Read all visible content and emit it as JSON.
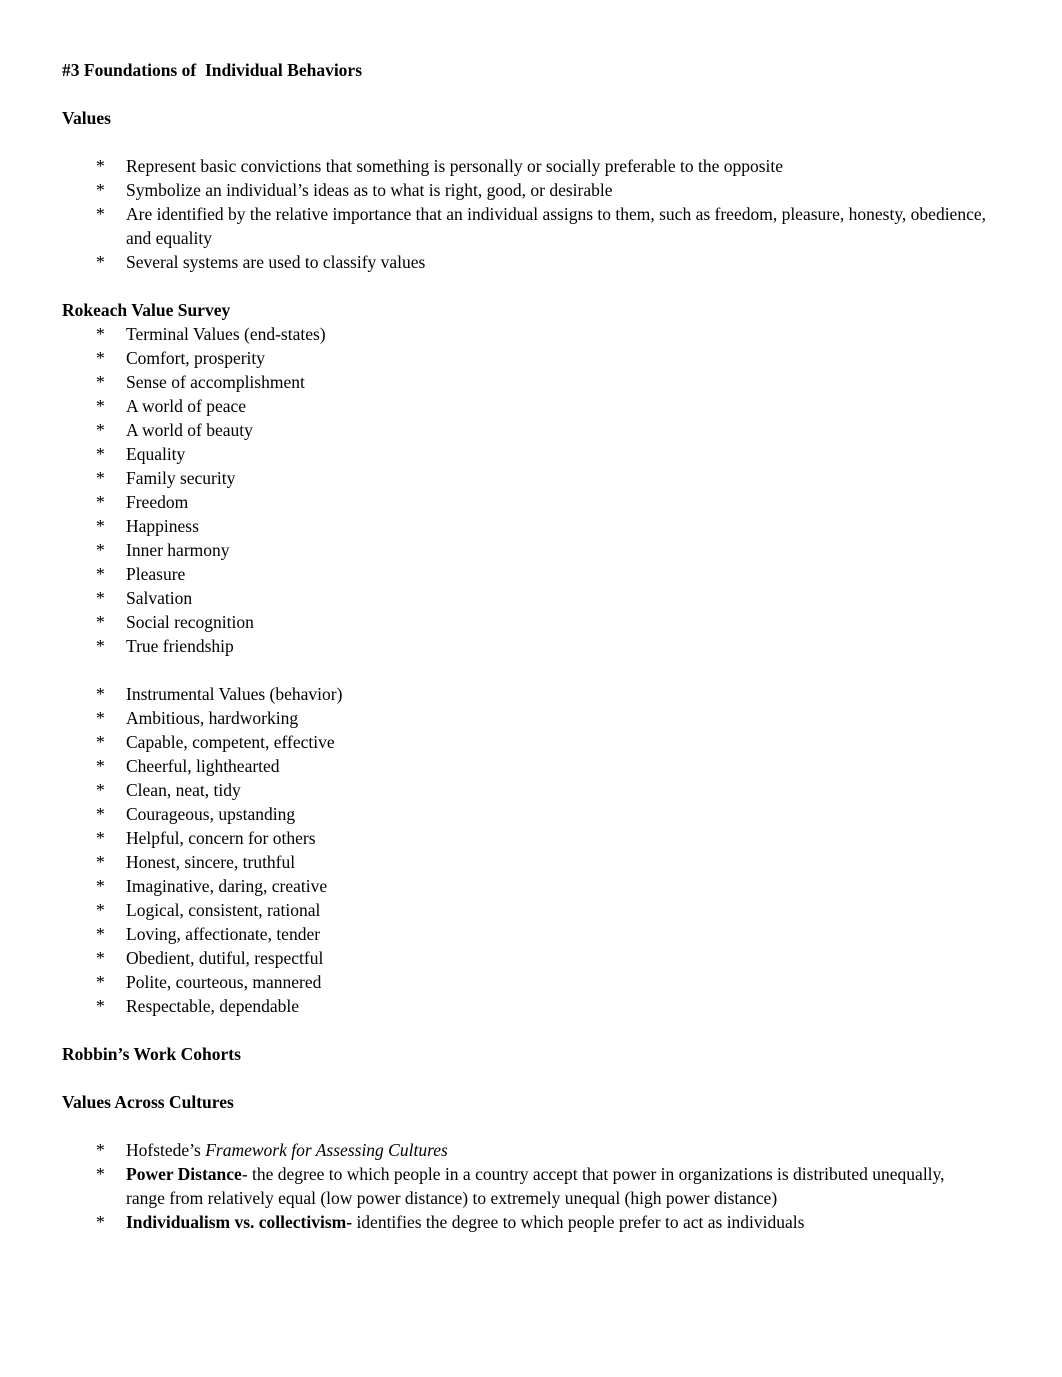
{
  "document": {
    "title": "#3 Foundations of  Individual Behaviors",
    "bullet_glyph": "*",
    "background_color": "#ffffff",
    "text_color": "#000000",
    "sections": [
      {
        "heading": "Values",
        "gap_after_heading": true,
        "items": [
          {
            "text": "Represent basic convictions that something is personally or socially preferable to the opposite"
          },
          {
            "text": "Symbolize an individual’s ideas as to what is right, good, or desirable"
          },
          {
            "text": "Are identified by the relative importance that an individual assigns to them, such as freedom, pleasure, honesty, obedience, and equality"
          },
          {
            "text": "Several systems are used to classify values"
          }
        ]
      },
      {
        "heading": "Rokeach Value Survey",
        "gap_after_heading": false,
        "items": [
          {
            "text": "Terminal Values (end-states)"
          },
          {
            "text": "Comfort, prosperity"
          },
          {
            "text": "Sense of accomplishment"
          },
          {
            "text": "A world of peace"
          },
          {
            "text": "A world of beauty"
          },
          {
            "text": "Equality"
          },
          {
            "text": "Family security"
          },
          {
            "text": "Freedom"
          },
          {
            "text": "Happiness"
          },
          {
            "text": "Inner harmony"
          },
          {
            "text": "Pleasure"
          },
          {
            "text": "Salvation"
          },
          {
            "text": "Social recognition"
          },
          {
            "text": "True friendship"
          },
          {
            "blank": true
          },
          {
            "text": "Instrumental Values (behavior)"
          },
          {
            "text": "Ambitious, hardworking"
          },
          {
            "text": "Capable, competent, effective"
          },
          {
            "text": "Cheerful, lighthearted"
          },
          {
            "text": "Clean, neat, tidy"
          },
          {
            "text": "Courageous, upstanding"
          },
          {
            "text": "Helpful, concern for others"
          },
          {
            "text": "Honest, sincere, truthful"
          },
          {
            "text": "Imaginative, daring, creative"
          },
          {
            "text": "Logical, consistent, rational"
          },
          {
            "text": "Loving, affectionate, tender"
          },
          {
            "text": "Obedient, dutiful, respectful"
          },
          {
            "text": "Polite, courteous, mannered"
          },
          {
            "text": "Respectable, dependable"
          }
        ]
      },
      {
        "heading": "Robbin’s Work Cohorts",
        "gap_after_heading": false,
        "items": []
      },
      {
        "heading": "Values Across Cultures",
        "gap_after_heading": true,
        "items": [
          {
            "runs": [
              {
                "text": "Hofstede’s ",
                "style": "normal"
              },
              {
                "text": "Framework for Assessing Cultures",
                "style": "italic"
              }
            ]
          },
          {
            "runs": [
              {
                "text": "Power Distance",
                "style": "bold"
              },
              {
                "text": "- the degree to which people in a country accept that power in organizations is distributed unequally, range from relatively equal (low power distance) to extremely unequal (high power distance)",
                "style": "normal"
              }
            ]
          },
          {
            "runs": [
              {
                "text": "Individualism vs. collectivism-",
                "style": "bold"
              },
              {
                "text": " identifies the degree to which people prefer to act as individuals",
                "style": "normal"
              }
            ]
          }
        ]
      }
    ]
  }
}
